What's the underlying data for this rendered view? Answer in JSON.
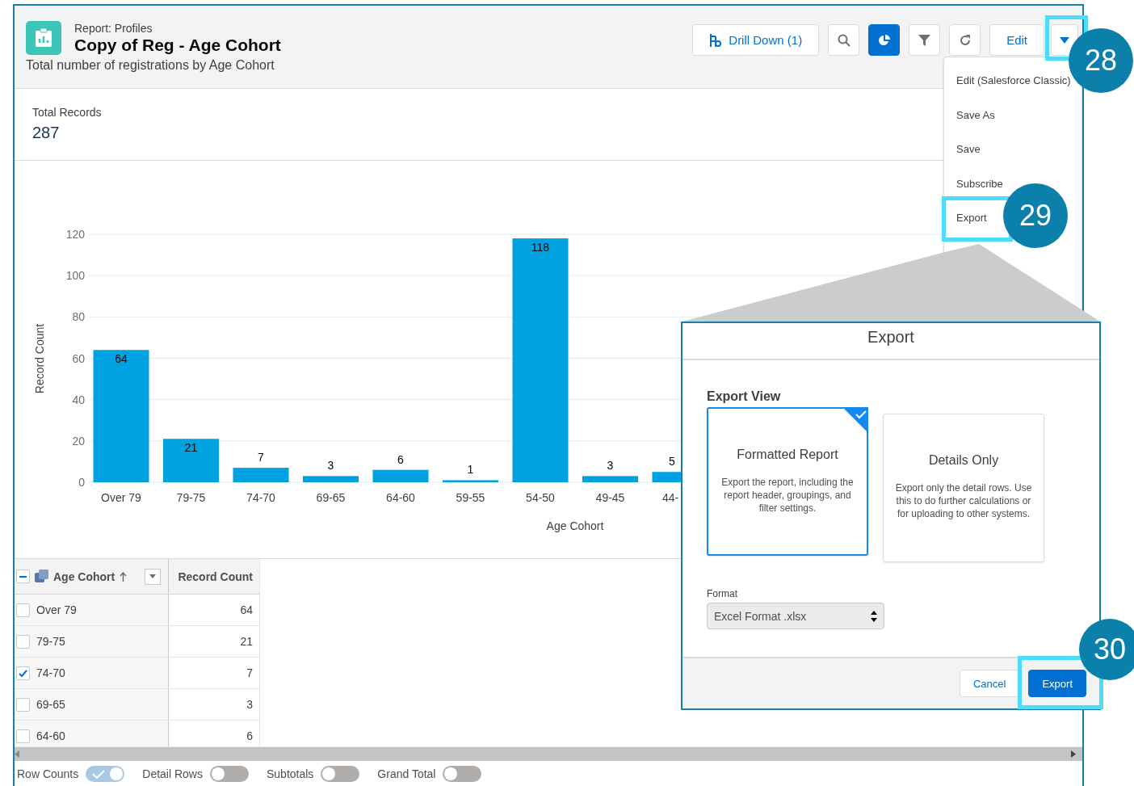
{
  "report": {
    "type_label": "Report: Profiles",
    "title": "Copy of Reg - Age Cohort",
    "description": "Total number of registrations by Age Cohort"
  },
  "toolbar": [
    {
      "kind": "drill",
      "label": "Drill Down (1)"
    },
    {
      "kind": "search"
    },
    {
      "kind": "chart"
    },
    {
      "kind": "filter"
    },
    {
      "kind": "refresh"
    },
    {
      "kind": "edit",
      "label": "Edit"
    },
    {
      "kind": "more"
    }
  ],
  "menu": {
    "items": [
      "Edit (Salesforce Classic)",
      "Save As",
      "Save",
      "Subscribe",
      "Export"
    ]
  },
  "summary": {
    "label": "Total Records",
    "value": "287"
  },
  "chart": {
    "chart_data": {
      "type": "bar",
      "xlabel": "Age Cohort",
      "ylabel": "Record Count",
      "categories": [
        "Over 79",
        "79-75",
        "74-70",
        "69-65",
        "64-60",
        "59-55",
        "54-50",
        "49-45",
        "44-"
      ],
      "values": [
        64,
        21,
        7,
        3,
        6,
        1,
        118,
        3,
        5
      ],
      "ylim": [
        0,
        120
      ],
      "yticks": [
        0,
        20,
        40,
        60,
        80,
        100,
        120
      ],
      "grid": true,
      "data_labels": true
    }
  },
  "table": {
    "columns": [
      "Age Cohort",
      "Record Count"
    ],
    "group_expanded": true,
    "rows": [
      {
        "cohort": "Over 79",
        "count": "64",
        "checked": false
      },
      {
        "cohort": "79-75",
        "count": "21",
        "checked": false
      },
      {
        "cohort": "74-70",
        "count": "7",
        "checked": true
      },
      {
        "cohort": "69-65",
        "count": "3",
        "checked": false
      },
      {
        "cohort": "64-60",
        "count": "6",
        "checked": false
      }
    ]
  },
  "toggles": [
    {
      "label": "Row Counts",
      "on": true
    },
    {
      "label": "Detail Rows",
      "on": false
    },
    {
      "label": "Subtotals",
      "on": false
    },
    {
      "label": "Grand Total",
      "on": false
    }
  ],
  "export_dialog": {
    "title": "Export",
    "section": "Export View",
    "options": [
      {
        "title": "Formatted Report",
        "description": "Export the report, including the report header, groupings, and filter settings.",
        "selected": true
      },
      {
        "title": "Details Only",
        "description": "Export only the detail rows. Use this to do further calculations or for uploading to other systems.",
        "selected": false
      }
    ],
    "format_label": "Format",
    "format_value": "Excel Format .xlsx",
    "buttons": [
      {
        "label": "Cancel",
        "kind": "neutral"
      },
      {
        "label": "Export",
        "kind": "brand"
      }
    ]
  },
  "callouts": [
    {
      "number": "28"
    },
    {
      "number": "29"
    },
    {
      "number": "30"
    }
  ]
}
